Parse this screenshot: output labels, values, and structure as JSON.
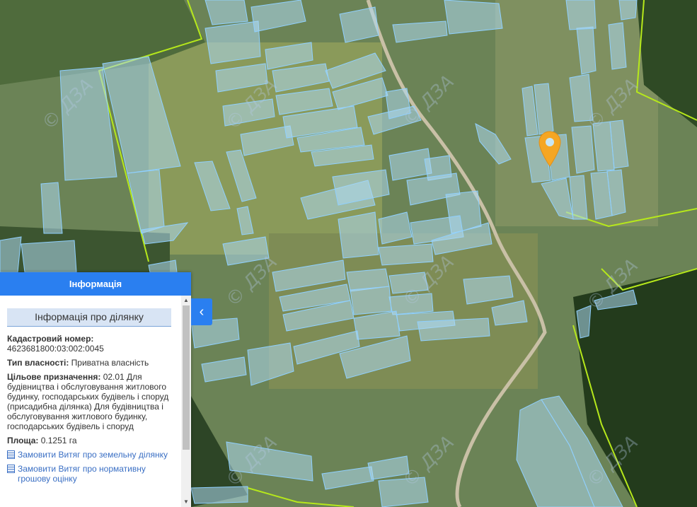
{
  "panel": {
    "header": "Інформація",
    "section_title": "Інформація про ділянку",
    "cadastral_label": "Кадастровий номер:",
    "cadastral_value": "4623681800:03:002:0045",
    "ownership_label": "Тип власності:",
    "ownership_value": "Приватна власність",
    "purpose_label": "Цільове призначення:",
    "purpose_value": "02.01 Для будівництва і обслуговування житлового будинку, господарських будівель і споруд (присадибна ділянка) Для будівництва і обслуговування житлового будинку, господарських будівель і споруд",
    "area_label": "Площа:",
    "area_value": "0.1251 га",
    "link_extract_land": "Замовити Витяг про земельну ділянку",
    "link_extract_normative": "Замовити Витяг про нормативну грошову оцінку"
  },
  "map": {
    "watermark": "© ДЗА",
    "marker_color": "#f5a623",
    "parcel_color": "#add8f0",
    "boundary_color": "#b6e81b"
  },
  "icons": {
    "collapse": "chevron-left-icon",
    "marker": "map-pin-icon",
    "document": "document-icon"
  }
}
